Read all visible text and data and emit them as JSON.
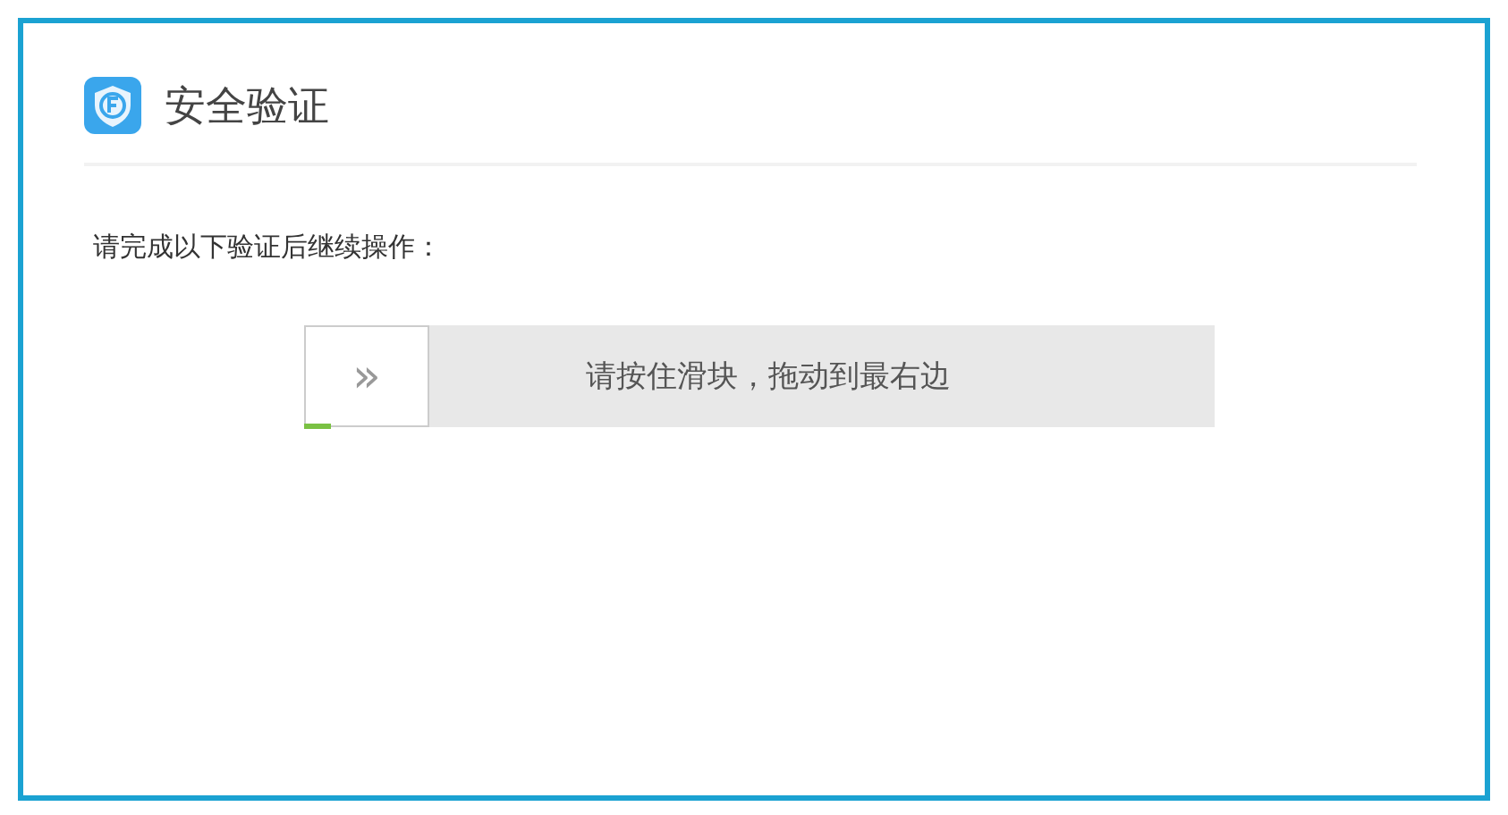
{
  "dialog": {
    "title": "安全验证"
  },
  "instruction": "请完成以下验证后继续操作：",
  "slider": {
    "handle_label": "»",
    "hint": "请按住滑块，拖动到最右边",
    "level": 0.03
  }
}
